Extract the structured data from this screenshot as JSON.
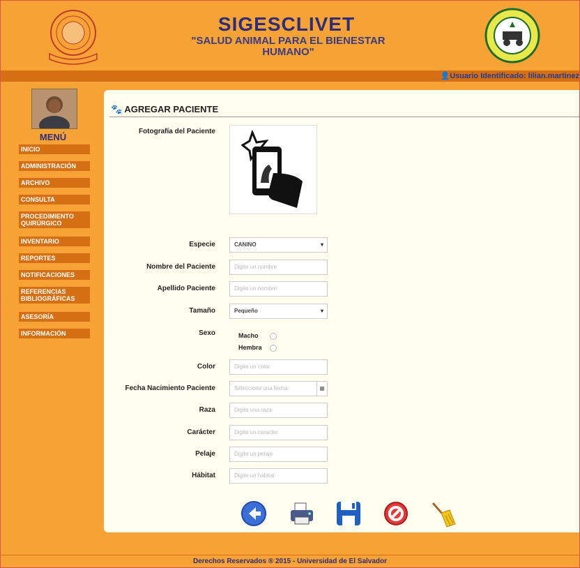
{
  "header": {
    "title": "SIGESCLIVET",
    "subtitle": "\"SALUD ANIMAL PARA EL BIENESTAR HUMANO\"",
    "user_label": "Usuario Identificado: lilian.martinez"
  },
  "sidebar": {
    "menu_title": "MENÚ",
    "items": [
      {
        "label": "INICIO"
      },
      {
        "label": "ADMINISTRACIÓN"
      },
      {
        "label": "ARCHIVO"
      },
      {
        "label": "CONSULTA"
      },
      {
        "label": "PROCEDIMIENTO QUIRÚRGICO"
      },
      {
        "label": "INVENTARIO"
      },
      {
        "label": "REPORTES"
      },
      {
        "label": "NOTIFICACIONES"
      },
      {
        "label": "REFERENCIAS BIBLIOGRÁFICAS"
      },
      {
        "label": "ASESORÍA"
      },
      {
        "label": "INFORMACIÓN"
      }
    ]
  },
  "form": {
    "title": "AGREGAR PACIENTE",
    "photo_label": "Fotografía del Paciente",
    "especie": {
      "label": "Especie",
      "value": "CANINO"
    },
    "nombre": {
      "label": "Nombre del Paciente",
      "placeholder": "Digite un nombre"
    },
    "apellido": {
      "label": "Apellido Paciente",
      "placeholder": "Digite un nombre"
    },
    "tamano": {
      "label": "Tamaño",
      "value": "Pequeño"
    },
    "sexo": {
      "label": "Sexo",
      "options": [
        "Macho",
        "Hembra"
      ]
    },
    "color": {
      "label": "Color",
      "placeholder": "Digite un color"
    },
    "fecha": {
      "label": "Fecha Nacimiento Paciente",
      "placeholder": "Seleccione una fecha"
    },
    "raza": {
      "label": "Raza",
      "placeholder": "Digite una raza"
    },
    "caracter": {
      "label": "Carácter",
      "placeholder": "Digite un caracter"
    },
    "pelaje": {
      "label": "Pelaje",
      "placeholder": "Digite un pelaje"
    },
    "habitat": {
      "label": "Hábitat",
      "placeholder": "Digite un hábitat"
    }
  },
  "actions": [
    {
      "icon": "back-arrow-icon"
    },
    {
      "icon": "printer-icon"
    },
    {
      "icon": "save-icon"
    },
    {
      "icon": "cancel-icon"
    },
    {
      "icon": "broom-icon"
    }
  ],
  "footer": {
    "text": "Derechos Reservados ® 2015 - Universidad de El Salvador"
  },
  "colors": {
    "background": "#f7a234",
    "menu": "#d46f13",
    "panel": "#fffff0",
    "title": "#2d2d7c"
  }
}
